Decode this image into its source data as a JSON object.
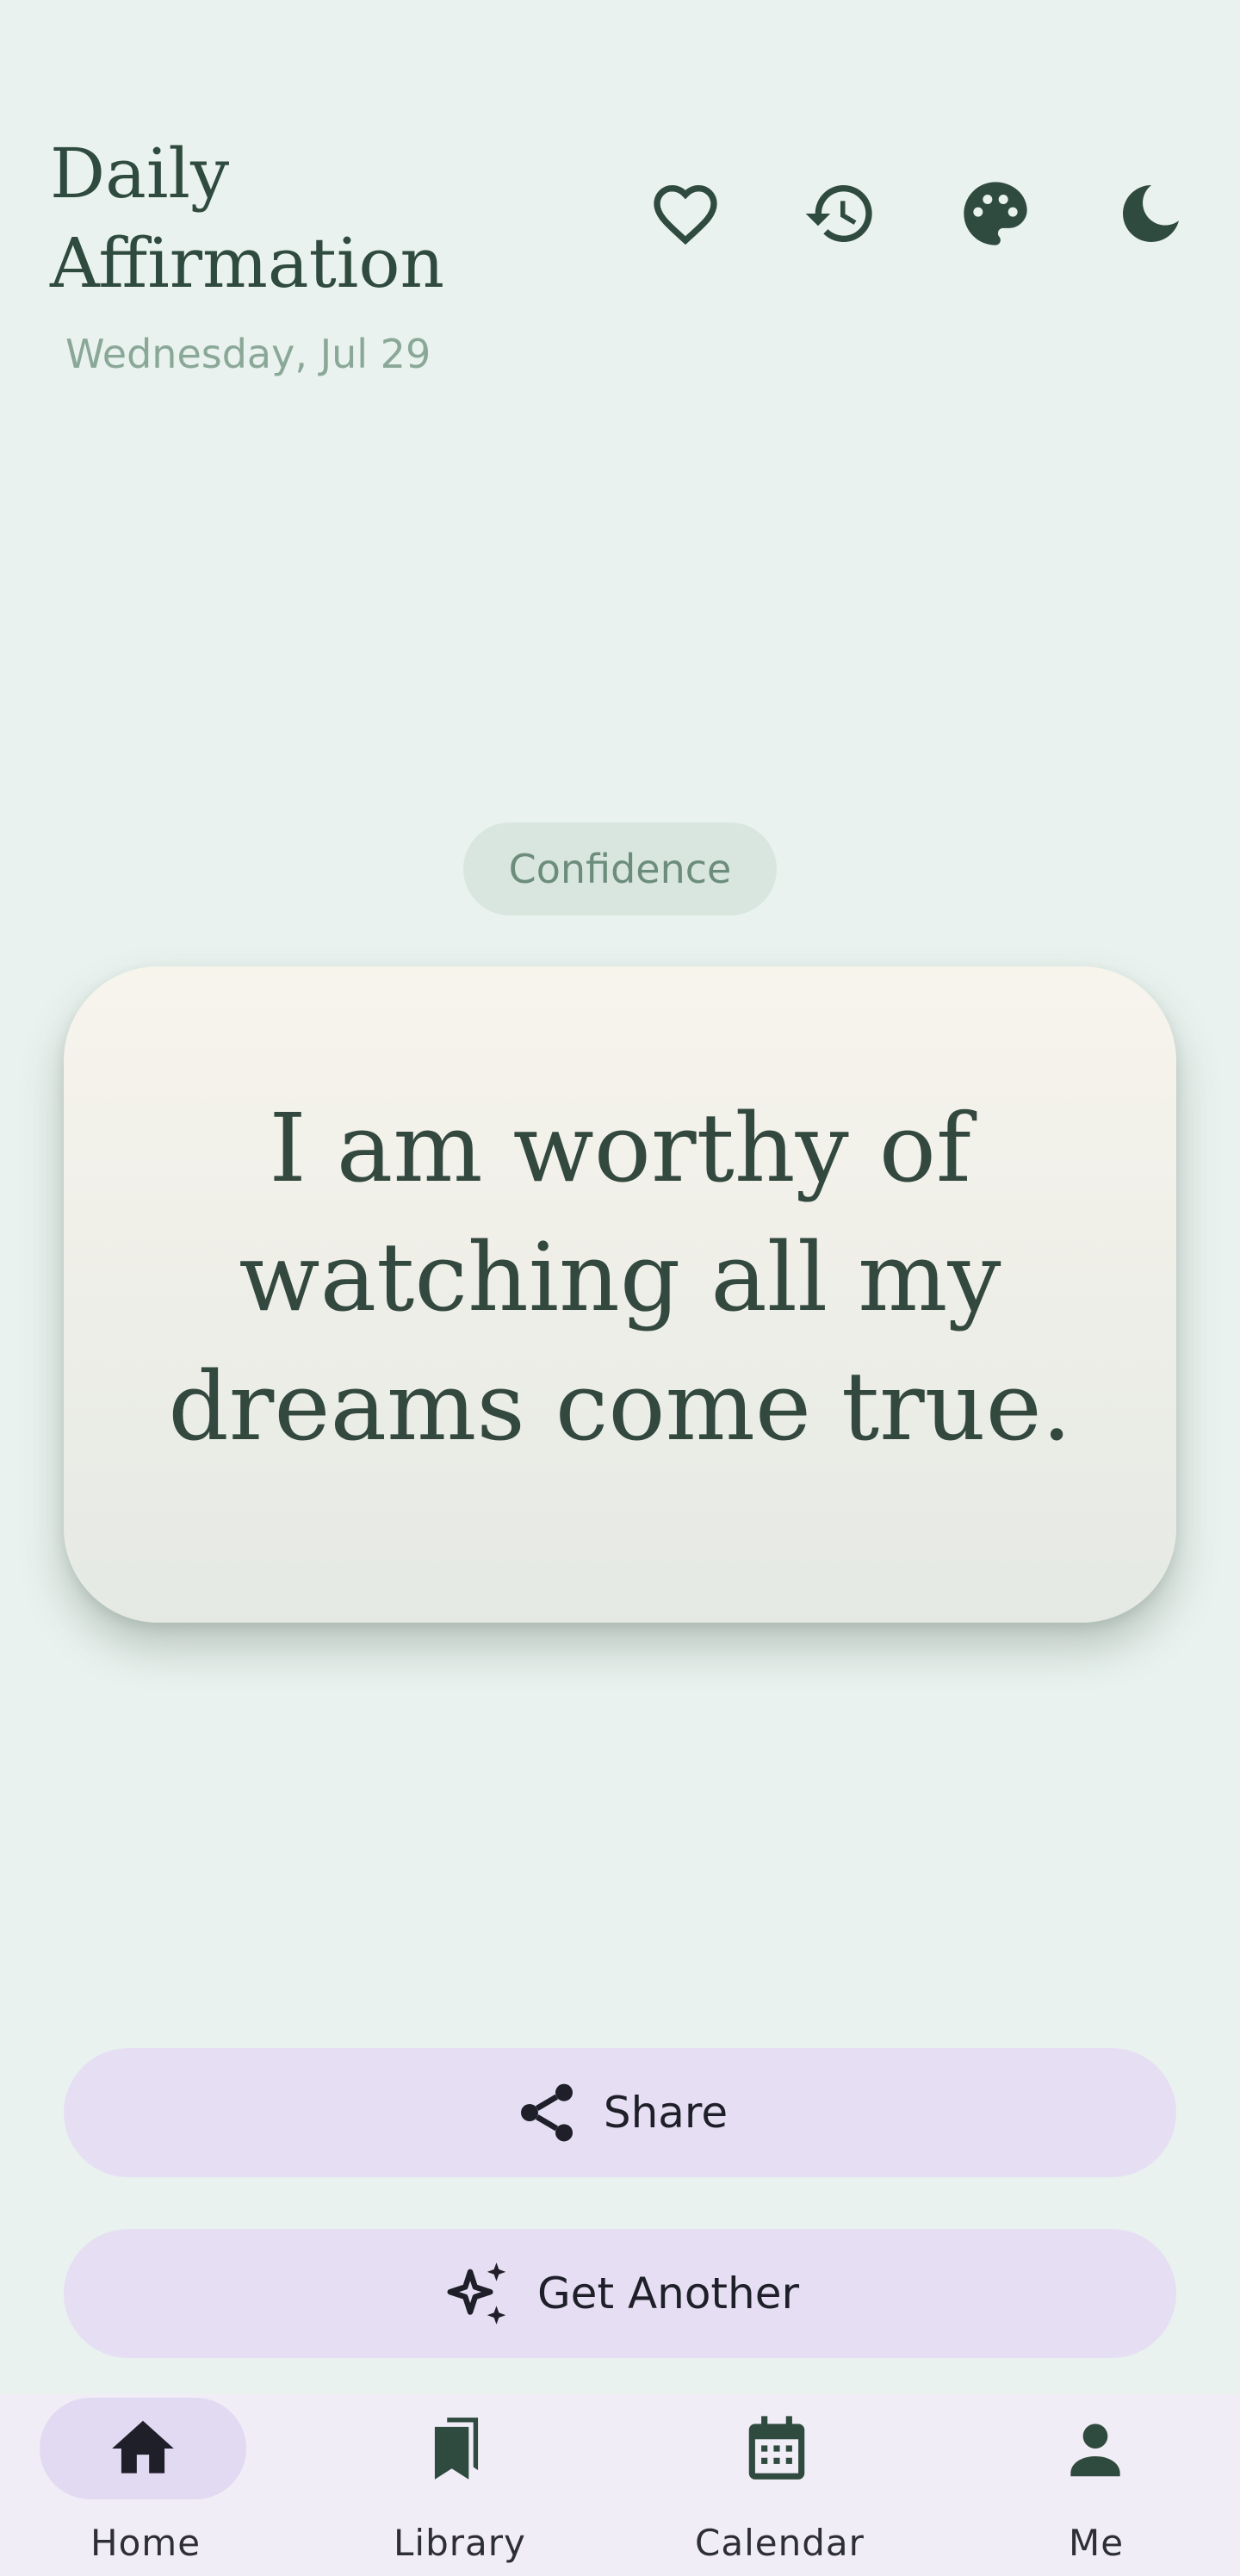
{
  "header": {
    "title": "Daily Affirmation",
    "date": "Wednesday, Jul 29",
    "icons": [
      "heart-outline-icon",
      "history-icon",
      "palette-icon",
      "moon-icon"
    ]
  },
  "affirmation": {
    "category": "Confidence",
    "text": "I am worthy of watching all my dreams come true."
  },
  "actions": {
    "share_label": "Share",
    "another_label": "Get Another"
  },
  "nav": {
    "items": [
      {
        "label": "Home",
        "icon": "home-icon",
        "active": true
      },
      {
        "label": "Library",
        "icon": "bookmarks-icon",
        "active": false
      },
      {
        "label": "Calendar",
        "icon": "calendar-icon",
        "active": false
      },
      {
        "label": "Me",
        "icon": "person-icon",
        "active": false
      }
    ]
  },
  "colors": {
    "background": "#e9f2ee",
    "primary_text": "#2f4a3e",
    "muted_text": "#8aa898",
    "chip_bg": "#d9e6e0",
    "button_bg": "#e6dff3",
    "nav_bg": "#f1edf6",
    "nav_active_pill": "#e2daf2"
  }
}
